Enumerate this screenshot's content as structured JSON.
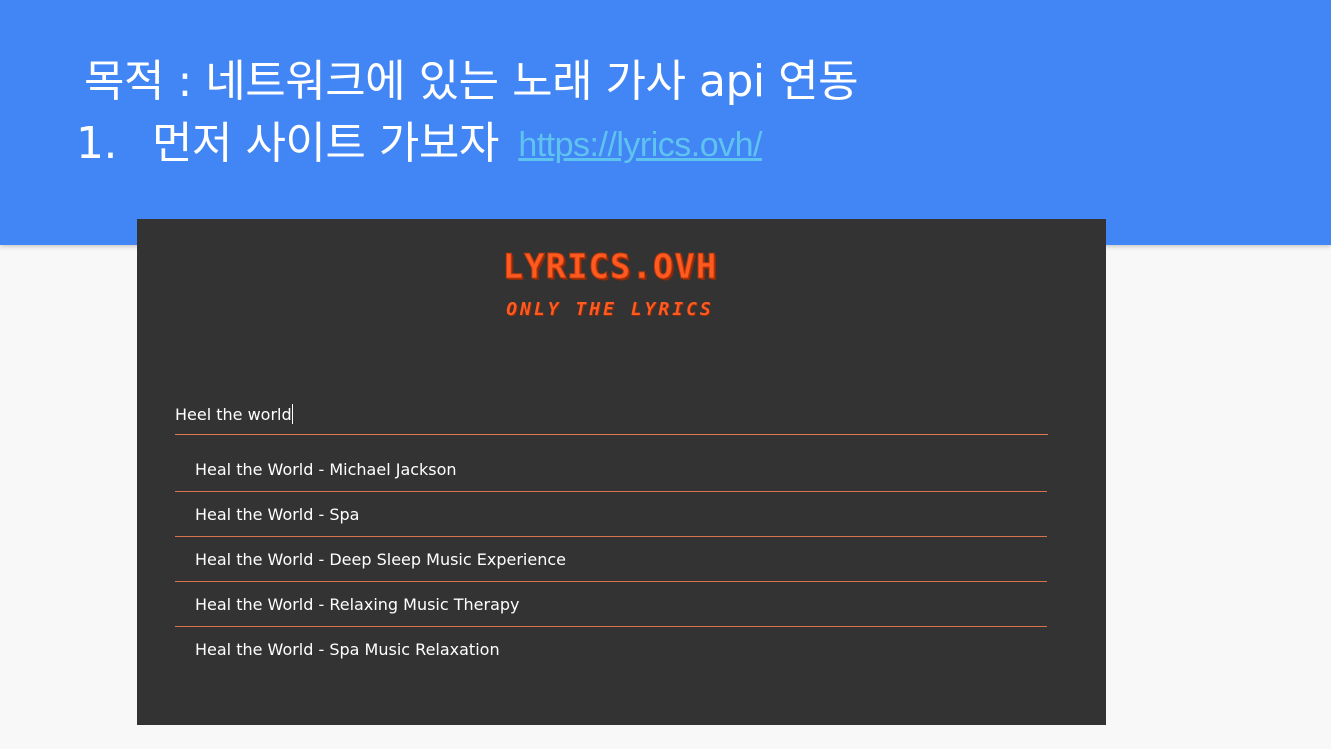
{
  "slide": {
    "title": "목적 : 네트워크에 있는 노래 가사 api 연동",
    "step_number": "1.",
    "step_text": "먼저 사이트 가보자",
    "step_link": "https://lyrics.ovh/"
  },
  "site": {
    "logo_title": "LYRICS.OVH",
    "logo_subtitle": "ONLY THE LYRICS",
    "search_value": "Heel the world",
    "results": [
      {
        "label": "Heal the World - Michael Jackson"
      },
      {
        "label": "Heal the World - Spa"
      },
      {
        "label": "Heal the World - Deep Sleep Music Experience"
      },
      {
        "label": "Heal the World - Relaxing Music Therapy"
      },
      {
        "label": "Heal the World - Spa Music Relaxation"
      }
    ]
  },
  "colors": {
    "header_blue": "#4285f4",
    "link_blue": "#5fc3f0",
    "site_bg": "#333333",
    "logo_orange": "#ff5a1f",
    "divider_orange": "#d9734e"
  }
}
